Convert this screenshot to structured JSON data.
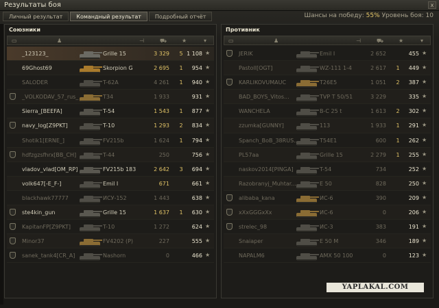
{
  "window": {
    "title": "Результаты боя",
    "close": "x"
  },
  "tabs": [
    "Личный результат",
    "Командный результат",
    "Подробный отчёт"
  ],
  "chance": {
    "prefix": "Шансы на победу:",
    "value": "55%",
    "level_label": "Уровень боя:",
    "level": "10"
  },
  "allies": {
    "name": "Союзники",
    "rows": [
      {
        "player": "_123123_",
        "vehicle": "Grille 15",
        "dmg": "3 329",
        "kills": "5",
        "xp": "1 108",
        "state": "hl",
        "icon": false,
        "tank_color": "#6b6a63"
      },
      {
        "player": "69Ghost69",
        "vehicle": "Skorpion G",
        "dmg": "2 695",
        "kills": "1",
        "xp": "954",
        "state": "alive",
        "icon": false,
        "tank_color": "#a87a2c"
      },
      {
        "player": "SALODER",
        "vehicle": "T-62A",
        "dmg": "4 261",
        "kills": "1",
        "xp": "940",
        "state": "dead",
        "icon": false,
        "tank_color": "#4c4a43"
      },
      {
        "player": "_VOLKODAV_57_rus_",
        "vehicle": "T34",
        "dmg": "1 933",
        "kills": "",
        "xp": "931",
        "state": "dead",
        "icon": true,
        "tank_color": "#8a6c34"
      },
      {
        "player": "Sierra_[BEEFA]",
        "vehicle": "T-54",
        "dmg": "1 543",
        "kills": "1",
        "xp": "877",
        "state": "alive",
        "icon": false,
        "tank_color": "#55534b"
      },
      {
        "player": "navy_log[Z9PKT]",
        "vehicle": "T-10",
        "dmg": "1 293",
        "kills": "2",
        "xp": "834",
        "state": "alive",
        "icon": true,
        "tank_color": "#4f4d46"
      },
      {
        "player": "Shotik1[ERNE_]",
        "vehicle": "FV215b",
        "dmg": "1 624",
        "kills": "1",
        "xp": "794",
        "state": "dead",
        "icon": false,
        "tank_color": "#4f4d46"
      },
      {
        "player": "hdfzgzsfhrx[BB_CH]",
        "vehicle": "T-44",
        "dmg": "250",
        "kills": "",
        "xp": "756",
        "state": "dead",
        "icon": true,
        "tank_color": "#4f4d46"
      },
      {
        "player": "vladov_vlad[OM_RP]",
        "vehicle": "FV215b 183",
        "dmg": "2 642",
        "kills": "3",
        "xp": "694",
        "state": "alive",
        "icon": false,
        "tank_color": "#5a5850"
      },
      {
        "player": "volk647[-E_F-]",
        "vehicle": "Emil I",
        "dmg": "671",
        "kills": "",
        "xp": "661",
        "state": "alive",
        "icon": false,
        "tank_color": "#4f4d46"
      },
      {
        "player": "blackhawk77777",
        "vehicle": "ИСУ-152",
        "dmg": "1 443",
        "kills": "",
        "xp": "638",
        "state": "dead",
        "icon": false,
        "tank_color": "#4f4d46"
      },
      {
        "player": "ste4kin_gun",
        "vehicle": "Grille 15",
        "dmg": "1 637",
        "kills": "1",
        "xp": "630",
        "state": "alive",
        "icon": true,
        "tank_color": "#5a5850"
      },
      {
        "player": "KapitanFP[Z9PKT]",
        "vehicle": "T-10",
        "dmg": "1 272",
        "kills": "",
        "xp": "624",
        "state": "dead",
        "icon": true,
        "tank_color": "#4f4d46"
      },
      {
        "player": "Minor37",
        "vehicle": "FV4202 (P)",
        "dmg": "227",
        "kills": "",
        "xp": "555",
        "state": "dead",
        "icon": true,
        "tank_color": "#8a6c34"
      },
      {
        "player": "sanek_tank4[CR_A]",
        "vehicle": "Nashorn",
        "dmg": "0",
        "kills": "",
        "xp": "466",
        "state": "dead",
        "icon": true,
        "tank_color": "#4f4d46"
      }
    ]
  },
  "enemies": {
    "name": "Противник",
    "rows": [
      {
        "player": "JERIK",
        "vehicle": "Emil I",
        "dmg": "2 652",
        "kills": "",
        "xp": "455",
        "state": "dead",
        "icon": true,
        "tank_color": "#4f4d46"
      },
      {
        "player": "Pastoll[OGT]",
        "vehicle": "WZ-111 1-4",
        "dmg": "2 617",
        "kills": "1",
        "xp": "449",
        "state": "dead",
        "icon": false,
        "tank_color": "#4f4d46"
      },
      {
        "player": "KARLIKOVUMAUC",
        "vehicle": "T26E5",
        "dmg": "1 051",
        "kills": "2",
        "xp": "387",
        "state": "dead",
        "icon": true,
        "tank_color": "#8a6c34"
      },
      {
        "player": "BAD_BOYS_Vitos...",
        "vehicle": "TVP T 50/51",
        "dmg": "3 229",
        "kills": "",
        "xp": "335",
        "state": "dead",
        "icon": false,
        "tank_color": "#4f4d46"
      },
      {
        "player": "WANCHELA",
        "vehicle": "B-C 25 t",
        "dmg": "1 613",
        "kills": "2",
        "xp": "302",
        "state": "dead",
        "icon": false,
        "tank_color": "#4f4d46"
      },
      {
        "player": "zzumka[GUNNY]",
        "vehicle": "113",
        "dmg": "1 933",
        "kills": "1",
        "xp": "291",
        "state": "dead",
        "icon": false,
        "tank_color": "#4f4d46"
      },
      {
        "player": "Spanch_BoB_38RUS...",
        "vehicle": "T54E1",
        "dmg": "600",
        "kills": "1",
        "xp": "262",
        "state": "dead",
        "icon": false,
        "tank_color": "#4f4d46"
      },
      {
        "player": "PL57aa",
        "vehicle": "Grille 15",
        "dmg": "2 279",
        "kills": "1",
        "xp": "255",
        "state": "dead",
        "icon": false,
        "tank_color": "#4f4d46"
      },
      {
        "player": "naskov2014[PINGA]",
        "vehicle": "T-54",
        "dmg": "734",
        "kills": "",
        "xp": "252",
        "state": "dead",
        "icon": false,
        "tank_color": "#4f4d46"
      },
      {
        "player": "Razobranyj_Muhtar...",
        "vehicle": "E 50",
        "dmg": "828",
        "kills": "",
        "xp": "250",
        "state": "dead",
        "icon": false,
        "tank_color": "#4f4d46"
      },
      {
        "player": "alibaba_kana",
        "vehicle": "ИС-6",
        "dmg": "390",
        "kills": "",
        "xp": "209",
        "state": "dead",
        "icon": true,
        "tank_color": "#8a6c34"
      },
      {
        "player": "xXxGGGxXx",
        "vehicle": "ИС-6",
        "dmg": "0",
        "kills": "",
        "xp": "206",
        "state": "dead",
        "icon": true,
        "tank_color": "#8a6c34"
      },
      {
        "player": "strelec_98",
        "vehicle": "ИС-3",
        "dmg": "383",
        "kills": "",
        "xp": "191",
        "state": "dead",
        "icon": true,
        "tank_color": "#4f4d46"
      },
      {
        "player": "Snaiaper",
        "vehicle": "E 50 M",
        "dmg": "346",
        "kills": "",
        "xp": "189",
        "state": "dead",
        "icon": false,
        "tank_color": "#4f4d46"
      },
      {
        "player": "NAPALM6",
        "vehicle": "AMX 50 100",
        "dmg": "0",
        "kills": "",
        "xp": "123",
        "state": "dead",
        "icon": false,
        "tank_color": "#4f4d46"
      }
    ]
  },
  "watermark": "YAPLAKAL.COM"
}
